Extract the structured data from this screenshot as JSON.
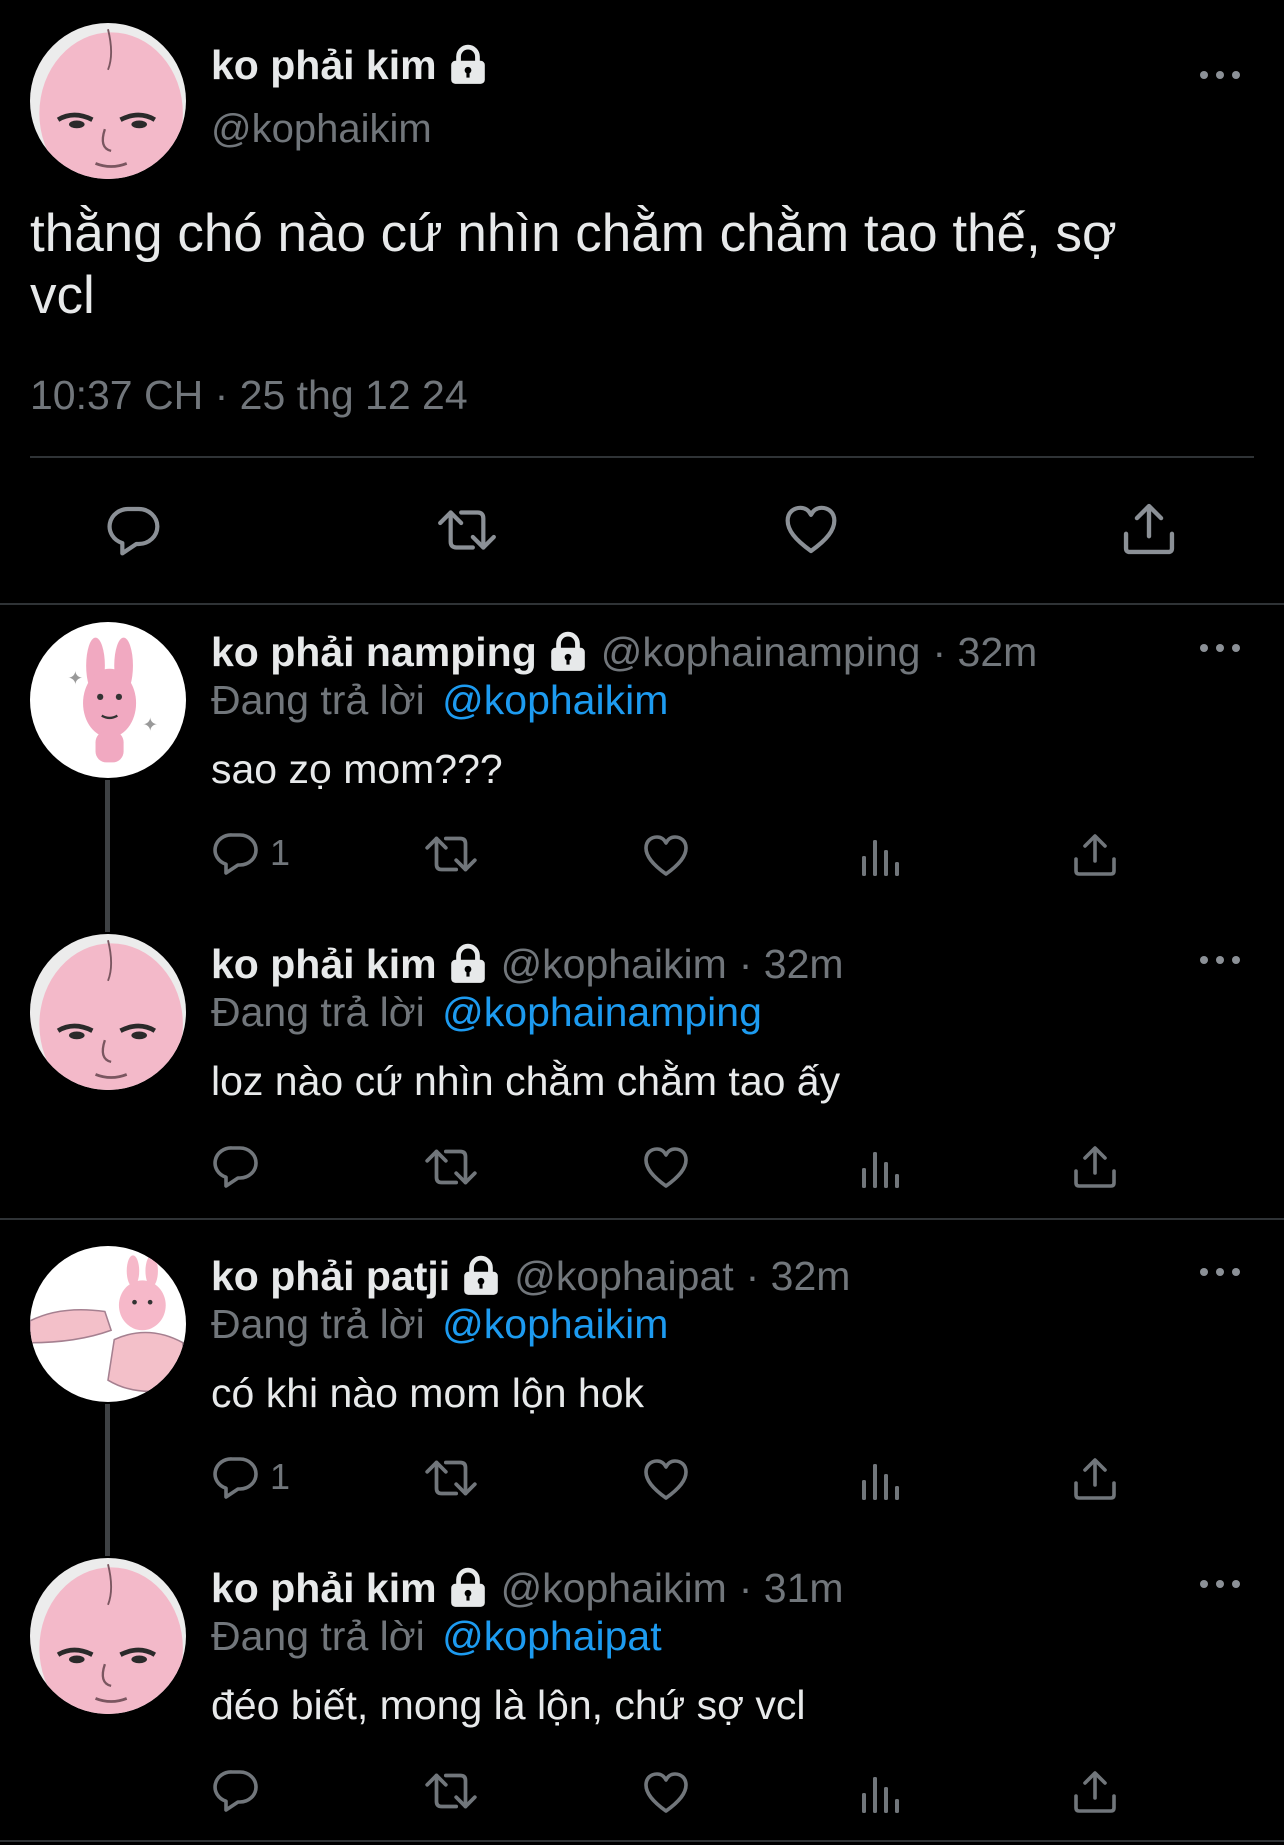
{
  "main_tweet": {
    "display_name": "ko phải kim",
    "handle": "@kophaikim",
    "text_line1": "thằng chó nào cứ nhìn chằm chằm tao thế, sợ",
    "text_line2": "vcl",
    "timestamp": "10:37 CH · 25 thg 12 24",
    "actions": [
      "reply-icon",
      "retweet-icon",
      "like-icon",
      "share-icon"
    ]
  },
  "replies": [
    {
      "display_name": "ko phải namping",
      "handle": "@kophainamping",
      "time": "· 32m",
      "replying_prefix": "Đang trả lời",
      "replying_to": "@kophaikim",
      "text": "sao zọ mom???",
      "reply_count": "1"
    },
    {
      "display_name": "ko phải kim",
      "handle": "@kophaikim",
      "time": "· 32m",
      "replying_prefix": "Đang trả lời",
      "replying_to": "@kophainamping",
      "text": "loz nào cứ nhìn chằm chằm tao ấy",
      "reply_count": ""
    },
    {
      "display_name": "ko phải patji",
      "handle": "@kophaipat",
      "time": "· 32m",
      "replying_prefix": "Đang trả lời",
      "replying_to": "@kophaikim",
      "text": "có khi nào mom lộn hok",
      "reply_count": "1"
    },
    {
      "display_name": "ko phải kim",
      "handle": "@kophaikim",
      "time": "· 31m",
      "replying_prefix": "Đang trả lời",
      "replying_to": "@kophaipat",
      "text": "đéo biết, mong là lộn, chứ sợ vcl",
      "reply_count": ""
    }
  ],
  "colors": {
    "background": "#000000",
    "text": "#e7e9ea",
    "secondary": "#71767b",
    "link": "#1d9bf0",
    "divider": "#2f3336"
  }
}
